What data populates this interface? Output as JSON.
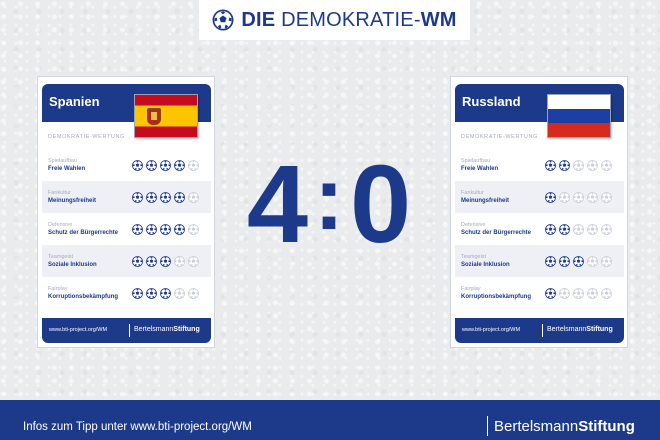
{
  "logo": {
    "bold1": "DIE",
    "light": " DEMOKRATIE-",
    "bold2": "WM",
    "icon": "soccer-ball-icon"
  },
  "left_card": {
    "team": "Spanien",
    "flag": "spain-flag",
    "rating_title": "DEMOKRATIE-WERTUNG",
    "rows": [
      {
        "category": "Spielaufbau",
        "criterion": "Freie Wahlen",
        "score": 4
      },
      {
        "category": "Fankultur",
        "criterion": "Meinungsfreiheit",
        "score": 4
      },
      {
        "category": "Defensive",
        "criterion": "Schutz der Bürgerrechte",
        "score": 4
      },
      {
        "category": "Teamgeist",
        "criterion": "Soziale Inklusion",
        "score": 3
      },
      {
        "category": "Fairplay",
        "criterion": "Korruptionsbekämpfung",
        "score": 3
      }
    ],
    "footer_url": "www.bti-project.org/WM",
    "footer_brand_light": "Bertelsmann",
    "footer_brand_bold": "Stiftung"
  },
  "right_card": {
    "team": "Russland",
    "flag": "russia-flag",
    "rating_title": "DEMOKRATIE-WERTUNG",
    "rows": [
      {
        "category": "Spielaufbau",
        "criterion": "Freie Wahlen",
        "score": 2
      },
      {
        "category": "Fankultur",
        "criterion": "Meinungsfreiheit",
        "score": 1
      },
      {
        "category": "Defensive",
        "criterion": "Schutz der Bürgerrechte",
        "score": 2
      },
      {
        "category": "Teamgeist",
        "criterion": "Soziale Inklusion",
        "score": 3
      },
      {
        "category": "Fairplay",
        "criterion": "Korruptionsbekämpfung",
        "score": 1
      }
    ],
    "footer_url": "www.bti-project.org/WM",
    "footer_brand_light": "Bertelsmann",
    "footer_brand_bold": "Stiftung"
  },
  "max_score": 5,
  "score": {
    "left": "4",
    "separator": ":",
    "right": "0"
  },
  "bottom_bar": {
    "info": "Infos zum Tipp unter www.bti-project.org/WM",
    "brand_light": "Bertelsmann",
    "brand_bold": "Stiftung"
  },
  "colors": {
    "brand_blue": "#1d3a8a",
    "filled_ball": "#1d3a8a",
    "empty_ball": "#c9ced8"
  }
}
